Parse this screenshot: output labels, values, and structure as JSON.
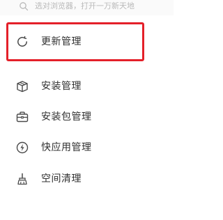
{
  "search": {
    "placeholder": "选对浏览器，打开一万新天地",
    "icon": "search-icon"
  },
  "menu": {
    "items": [
      {
        "label": "更新管理",
        "icon": "refresh-icon",
        "highlighted": true
      },
      {
        "label": "安装管理",
        "icon": "package-install-icon"
      },
      {
        "label": "安装包管理",
        "icon": "briefcase-icon"
      },
      {
        "label": "快应用管理",
        "icon": "lightning-icon"
      },
      {
        "label": "空间清理",
        "icon": "broom-icon"
      }
    ]
  },
  "colors": {
    "highlight_border": "#e42029",
    "text": "#303030",
    "icon": "#4a4a4a",
    "placeholder": "#b9b9b9"
  }
}
